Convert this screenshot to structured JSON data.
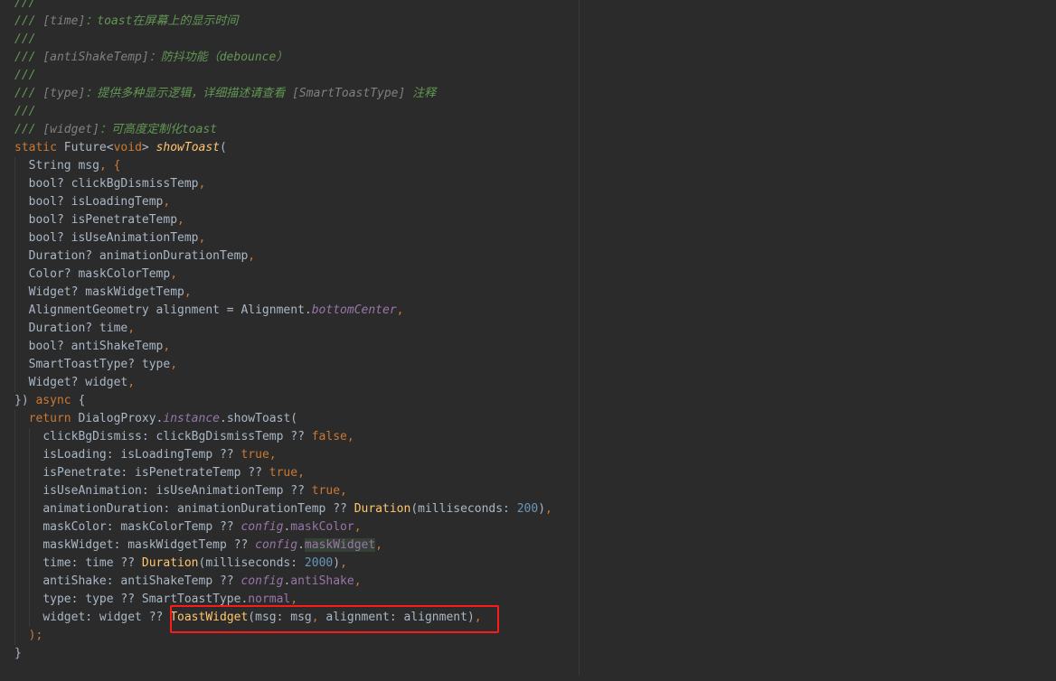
{
  "doc": {
    "l1": "///",
    "l2a": "/// ",
    "l2r": "[time]",
    "l2b": "：toast在屏幕上的显示时间",
    "l3": "///",
    "l4a": "/// ",
    "l4r": "[antiShakeTemp]",
    "l4b": "：防抖功能（debounce）",
    "l5": "///",
    "l6a": "/// ",
    "l6r": "[type]",
    "l6b": "：提供多种显示逻辑，详细描述请查看 ",
    "l6r2": "[SmartToastType]",
    "l6c": " 注释",
    "l7": "///",
    "l8a": "/// ",
    "l8r": "[widget]",
    "l8b": "：可高度定制化toast"
  },
  "sig": {
    "static_kw": "static",
    "future": " Future<",
    "void_kw": "void",
    "close": "> ",
    "fn_name": "showToast",
    "paren": "("
  },
  "params": [
    {
      "type": "String msg",
      "sep": ", {"
    },
    {
      "type": "bool? clickBgDismissTemp",
      "sep": ","
    },
    {
      "type": "bool? isLoadingTemp",
      "sep": ","
    },
    {
      "type": "bool? isPenetrateTemp",
      "sep": ","
    },
    {
      "type": "bool? isUseAnimationTemp",
      "sep": ","
    },
    {
      "type": "Duration? animationDurationTemp",
      "sep": ","
    },
    {
      "type": "Color? maskColorTemp",
      "sep": ","
    },
    {
      "type": "Widget? maskWidgetTemp",
      "sep": ","
    },
    {
      "type": "AlignmentGeometry alignment = Alignment.",
      "prop": "bottomCenter",
      "sep": ","
    },
    {
      "type": "Duration? time",
      "sep": ","
    },
    {
      "type": "bool? antiShakeTemp",
      "sep": ","
    },
    {
      "type": "SmartToastType? type",
      "sep": ","
    },
    {
      "type": "Widget? widget",
      "sep": ","
    }
  ],
  "async_line": {
    "close": "}) ",
    "async_kw": "async",
    "brace": " {"
  },
  "return_line": {
    "kw": "return",
    "rest": " DialogProxy.",
    "instance": "instance",
    "call": ".showToast("
  },
  "args": {
    "a1": "clickBgDismiss: clickBgDismissTemp ?? ",
    "a1v": "false",
    "a1s": ",",
    "a2": "isLoading: isLoadingTemp ?? ",
    "a2v": "true",
    "a2s": ",",
    "a3": "isPenetrate: isPenetrateTemp ?? ",
    "a3v": "true",
    "a3s": ",",
    "a4": "isUseAnimation: isUseAnimationTemp ?? ",
    "a4v": "true",
    "a4s": ",",
    "a5": "animationDuration: animationDurationTemp ?? ",
    "a5c": "Duration",
    "a5m": "(milliseconds: ",
    "a5n": "200",
    "a5e": ")",
    "a5s": ",",
    "a6": "maskColor: maskColorTemp ?? ",
    "a6c": "config",
    "a6d": ".",
    "a6p": "maskColor",
    "a6s": ",",
    "a7": "maskWidget: maskWidgetTemp ?? ",
    "a7c": "config",
    "a7d": ".",
    "a7p": "maskWidget",
    "a7s": ",",
    "a8": "time: time ?? ",
    "a8c": "Duration",
    "a8m": "(milliseconds: ",
    "a8n": "2000",
    "a8e": ")",
    "a8s": ",",
    "a9": "antiShake: antiShakeTemp ?? ",
    "a9c": "config",
    "a9d": ".",
    "a9p": "antiShake",
    "a9s": ",",
    "a10": "type: type ?? SmartToastType.",
    "a10p": "normal",
    "a10s": ",",
    "a11": "widget: widget ?? ",
    "a11c": "ToastWidget",
    "a11m": "(msg: msg",
    "a11k": ",",
    "a11n": " alignment: alignment)",
    "a11s": ","
  },
  "closing": {
    "paren": ");",
    "brace": "}"
  }
}
